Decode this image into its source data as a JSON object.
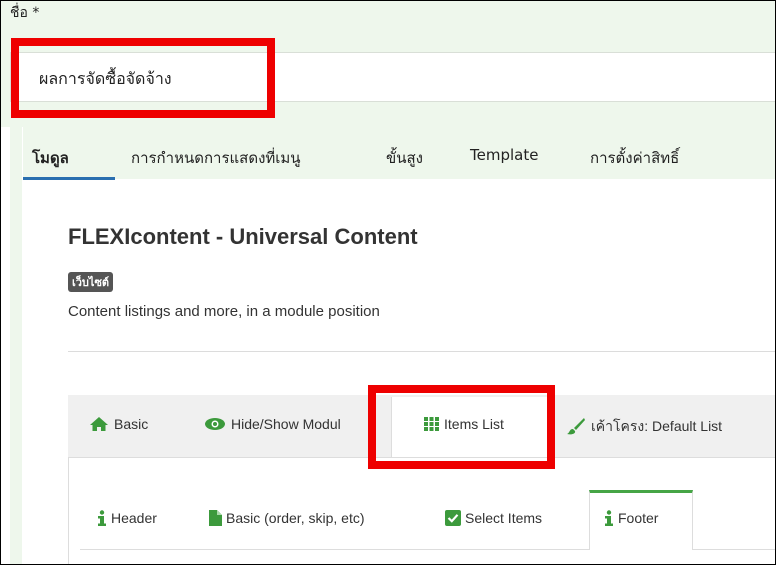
{
  "title_field": {
    "label": "ชื่อ",
    "required_mark": "*",
    "value": "ผลการจัดซื้อจัดจ้าง"
  },
  "main_tabs": [
    {
      "label": "โมดูล",
      "active": true
    },
    {
      "label": "การกำหนดการแสดงที่เมนู",
      "active": false
    },
    {
      "label": "ขั้นสูง",
      "active": false
    },
    {
      "label": "Template",
      "active": false
    },
    {
      "label": "การตั้งค่าสิทธิ์",
      "active": false
    }
  ],
  "module": {
    "title": "FLEXIcontent - Universal Content",
    "badge": "เว็บไซต์",
    "description": "Content listings and more, in a module position"
  },
  "sub_tabs": [
    {
      "label": "Basic",
      "icon": "home-icon",
      "active": false
    },
    {
      "label": "Hide/Show Modul",
      "icon": "eye-icon",
      "active": false
    },
    {
      "label": "Items List",
      "icon": "grid-icon",
      "active": true
    },
    {
      "label": "เค้าโครง: Default List",
      "icon": "brush-icon",
      "active": false
    }
  ],
  "inner_tabs": [
    {
      "label": "Header",
      "icon": "info-icon",
      "active": false
    },
    {
      "label": "Basic (order, skip, etc)",
      "icon": "file-icon",
      "active": false
    },
    {
      "label": "Select Items",
      "icon": "checkbox-icon",
      "active": false
    },
    {
      "label": "Footer",
      "icon": "info-icon",
      "active": true
    }
  ],
  "colors": {
    "highlight": "#ee0000",
    "active_tab_underline": "#2a6fb0",
    "icon_green": "#3c9a3c",
    "active_inner_tab_top": "#46a546"
  }
}
